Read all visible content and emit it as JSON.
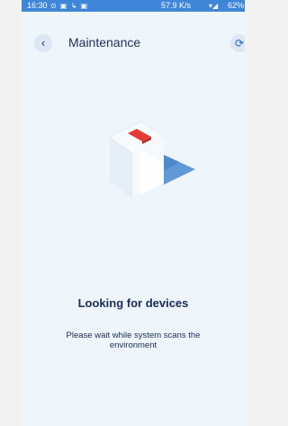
{
  "status_bar": {
    "time": "16:30",
    "left_icons": "⊙ ▣ ↳ ▣",
    "net_speed": "57.9 K/s",
    "signal": "▾◢",
    "battery": "62%"
  },
  "header": {
    "back_icon": "chevron-left-icon",
    "back_glyph": "‹",
    "title": "Maintenance",
    "refresh_icon": "refresh-icon",
    "refresh_glyph": "⟳"
  },
  "main": {
    "heading": "Looking for devices",
    "description": "Please wait while system scans the environment"
  },
  "colors": {
    "status_bar": "#3f86d8",
    "background": "#eef5fb",
    "accent": "#1d65c9",
    "text": "#1d2b55",
    "device_led": "#e53b37"
  }
}
